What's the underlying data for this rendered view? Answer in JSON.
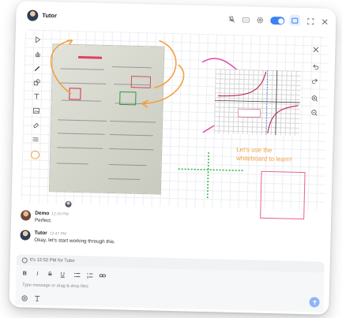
{
  "header": {
    "title": "Tutor",
    "icons": [
      "mic-off-icon",
      "caption-icon",
      "gear-icon",
      "toggle",
      "screen-share-icon",
      "fullscreen-icon",
      "close-icon"
    ],
    "toggle_on": true,
    "accent": "#3b82f6"
  },
  "toolbar": {
    "tools": [
      "pointer-icon",
      "hand-icon",
      "pen-icon",
      "shapes-icon",
      "text-icon",
      "image-icon",
      "eraser-icon",
      "lines-icon"
    ],
    "active_tool": "pen-icon",
    "selected_color": "#f3a34a"
  },
  "board": {
    "text_line1": "Let's use the",
    "text_line2": "whiteboard to learn!",
    "text_color": "#f2a040",
    "pen_colors": [
      "#f2a040",
      "#e04aa8",
      "#35b84a",
      "#e7628f"
    ]
  },
  "right_tools": [
    "close-icon",
    "undo-icon",
    "redo-icon",
    "zoom-in-icon",
    "zoom-out-icon"
  ],
  "messages": [
    {
      "sender": "Demo",
      "time": "12:43 PM",
      "text": "Perfect."
    },
    {
      "sender": "Tutor",
      "time": "12:47 PM",
      "text": "Okay, let's start working through this."
    }
  ],
  "status_banner": "It's 12:52 PM for Tutor",
  "composer": {
    "placeholder": "Type message or drag & drop files",
    "format_buttons": [
      "B",
      "I",
      "S",
      "U",
      "bullet-list-icon",
      "numbered-list-icon",
      "link-icon"
    ],
    "actions": [
      "attach-icon",
      "text-format-icon",
      "send-icon"
    ]
  }
}
